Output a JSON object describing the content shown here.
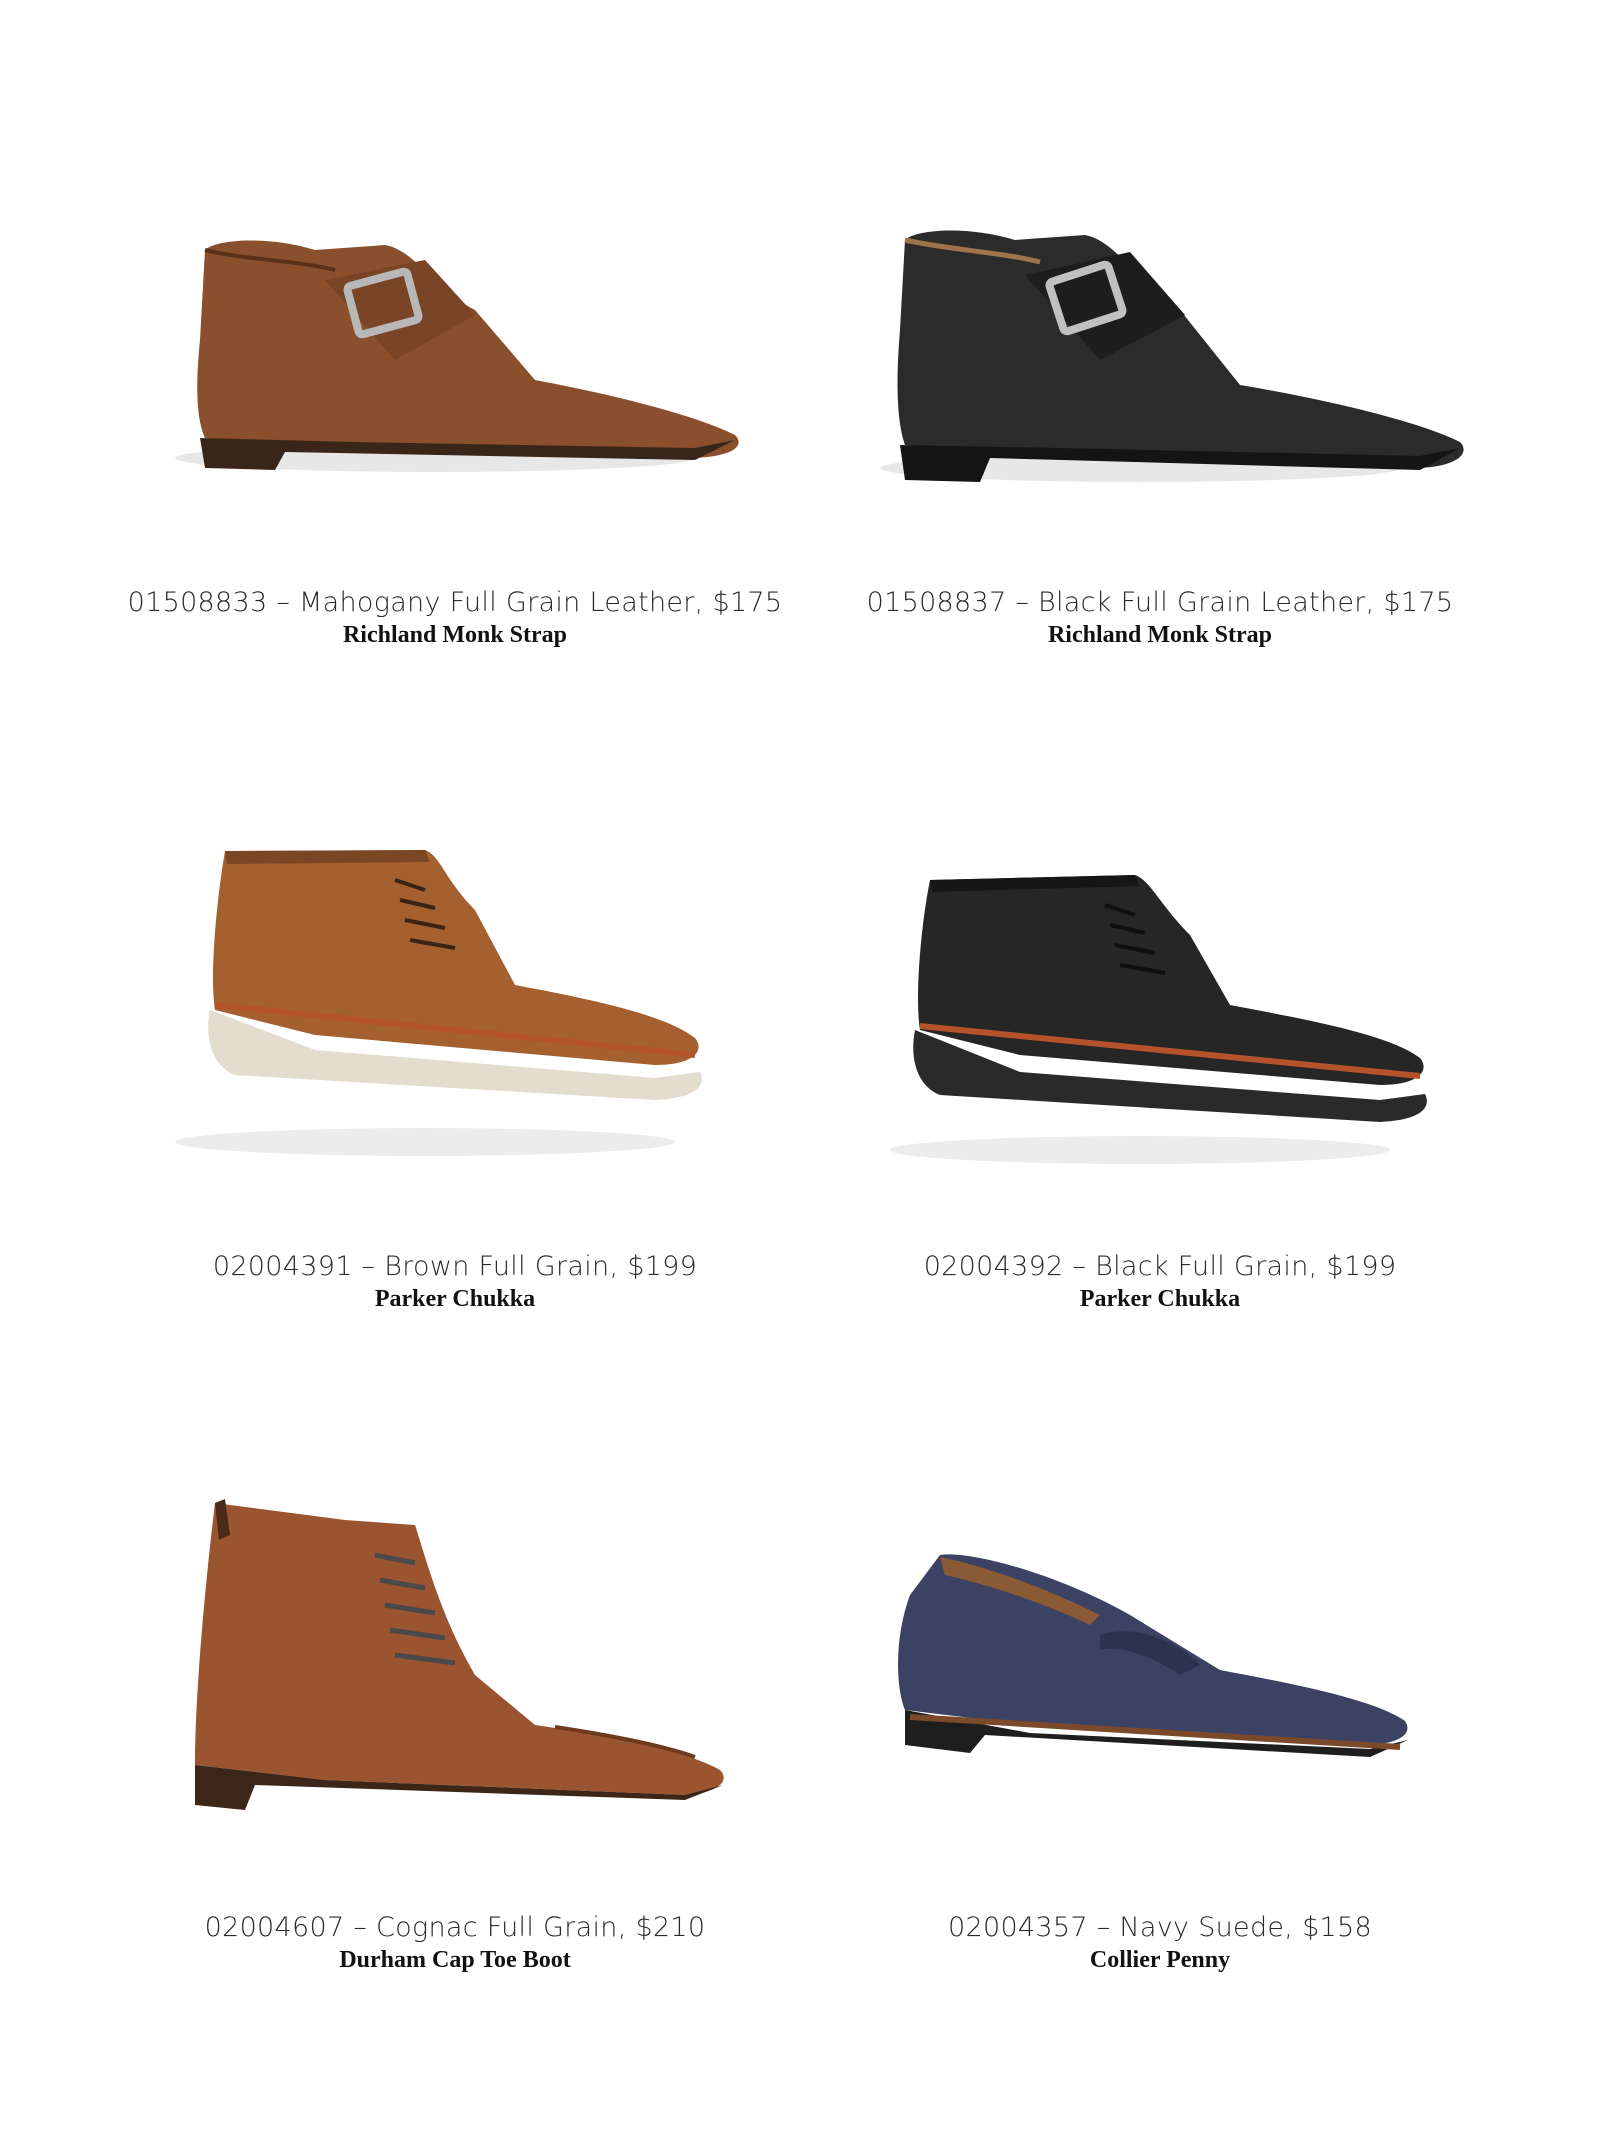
{
  "products": [
    {
      "spec": "01508833 – Mahogany Full Grain Leather, $175",
      "name": "Richland Monk Strap",
      "icon": "monk-strap-shoe",
      "upper_color": "#8a4f2c",
      "sole_color": "#3a2618"
    },
    {
      "spec": "01508837 – Black Full Grain Leather, $175",
      "name": "Richland Monk Strap",
      "icon": "monk-strap-shoe",
      "upper_color": "#2b2b2b",
      "sole_color": "#141414"
    },
    {
      "spec": "02004391 – Brown Full Grain, $199",
      "name": "Parker Chukka",
      "icon": "chukka-boot",
      "upper_color": "#a4612f",
      "sole_color": "#e3dccf"
    },
    {
      "spec": "02004392 – Black Full Grain, $199",
      "name": "Parker Chukka",
      "icon": "chukka-boot",
      "upper_color": "#262626",
      "sole_color": "#2a2a2a"
    },
    {
      "spec": "02004607 – Cognac Full Grain, $210",
      "name": "Durham Cap Toe Boot",
      "icon": "cap-toe-boot",
      "upper_color": "#9a5530",
      "sole_color": "#3b2618"
    },
    {
      "spec": "02004357 – Navy Suede, $158",
      "name": "Collier Penny",
      "icon": "penny-loafer",
      "upper_color": "#3b4263",
      "sole_color": "#1e1e1e"
    }
  ]
}
